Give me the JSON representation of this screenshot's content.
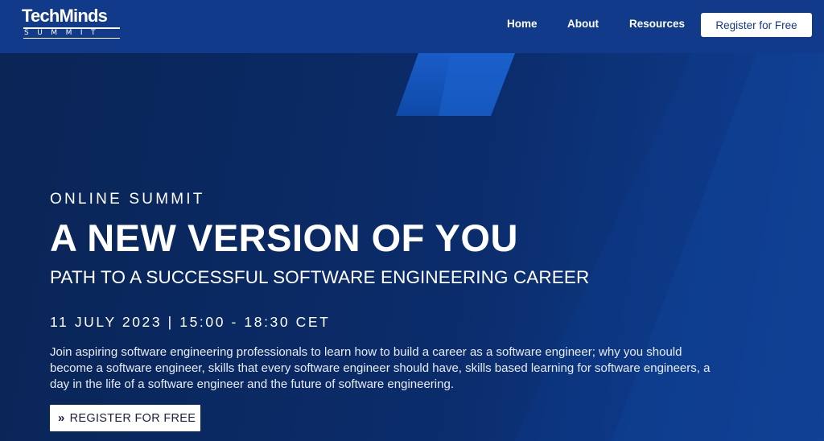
{
  "brand": {
    "name": "TechMinds",
    "tagline": "SUMMIT"
  },
  "nav": {
    "items": [
      {
        "label": "Home"
      },
      {
        "label": "About"
      },
      {
        "label": "Resources"
      }
    ],
    "register_label": "Register for Free"
  },
  "hero": {
    "eyebrow": "ONLINE SUMMIT",
    "headline": "A NEW VERSION OF YOU",
    "subhead": "PATH TO A SUCCESSFUL SOFTWARE ENGINEERING CAREER",
    "date": "11 JULY 2023 | 15:00 - 18:30 CET",
    "description": "Join aspiring software engineering professionals to learn how to build a career as a software engineer; why you should become a software engineer, skills that every software engineer should have, skills based learning for software engineers, a day in the life of a software engineer and the future of software engineering.",
    "cta_label": "REGISTER FOR FREE",
    "cta_icon": "double-chevron-right-icon"
  },
  "colors": {
    "nav_background": "#123a8a",
    "hero_background": "#0b2c6b",
    "accent_stripe": "#1250b4",
    "text": "#ffffff"
  }
}
